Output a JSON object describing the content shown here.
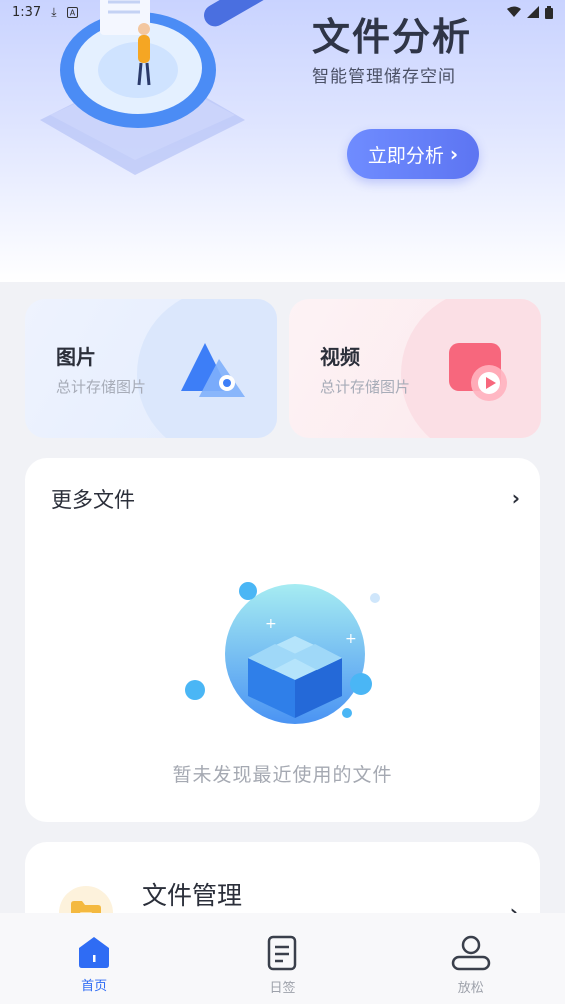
{
  "status_bar": {
    "time": "1:37"
  },
  "hero": {
    "title": "文件分析",
    "subtitle": "智能管理储存空间",
    "button_label": "立即分析"
  },
  "categories": [
    {
      "title": "图片",
      "subtitle": "总计存储图片",
      "icon": "image-icon"
    },
    {
      "title": "视频",
      "subtitle": "总计存储图片",
      "icon": "video-icon"
    }
  ],
  "more_files": {
    "title": "更多文件",
    "empty_text": "暂未发现最近使用的文件"
  },
  "file_management": {
    "title": "文件管理"
  },
  "bottom_nav": {
    "items": [
      {
        "label": "首页",
        "icon": "home-icon",
        "active": true
      },
      {
        "label": "日签",
        "icon": "document-icon",
        "active": false
      },
      {
        "label": "放松",
        "icon": "user-icon",
        "active": false
      }
    ]
  },
  "colors": {
    "accent": "#5d75f2",
    "nav_active": "#2f6cf4",
    "hero_top": "#c9d3ff"
  }
}
